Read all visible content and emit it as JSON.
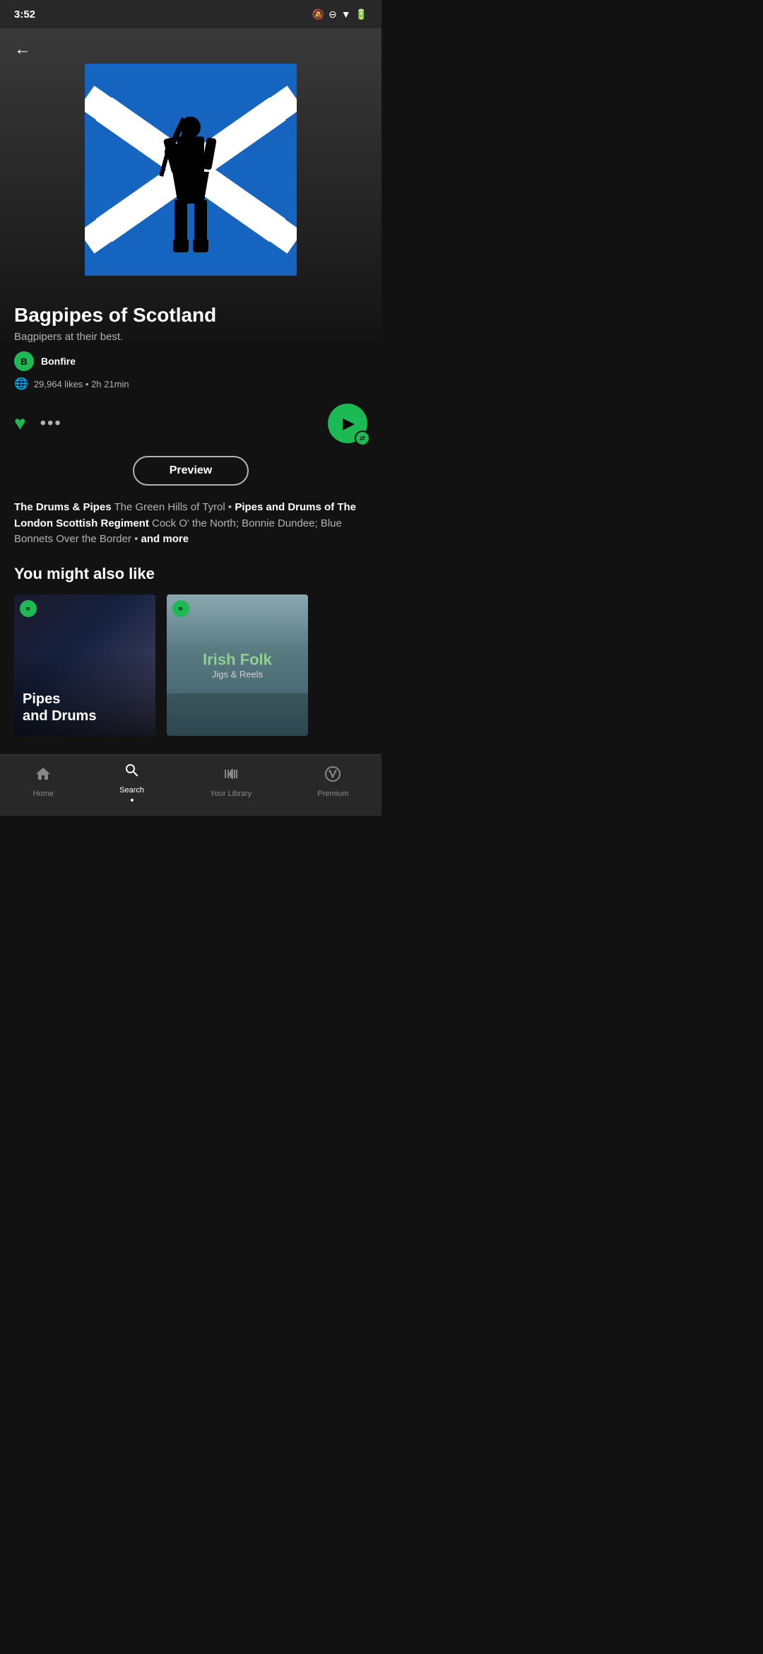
{
  "statusBar": {
    "time": "3:52",
    "icons": [
      "bell-off",
      "minus-circle",
      "wifi",
      "battery"
    ]
  },
  "header": {
    "backLabel": "←"
  },
  "playlist": {
    "title": "Bagpipes of Scotland",
    "subtitle": "Bagpipers at their best.",
    "creator": {
      "initial": "B",
      "name": "Bonfire"
    },
    "likes": "29,964 likes",
    "duration": "2h 21min",
    "metaText": "29,964 likes • 2h 21min"
  },
  "actions": {
    "heartLabel": "♥",
    "moreLabel": "•••",
    "playLabel": "▶",
    "shuffleLabel": "⇄"
  },
  "preview": {
    "label": "Preview"
  },
  "trackDescription": {
    "highlighted": "The Drums & Pipes",
    "text1": " The Green Hills of Tyrol • ",
    "highlighted2": "Pipes and Drums of The London Scottish Regiment",
    "text2": " Cock O' the North; Bonnie Dundee; Blue Bonnets Over the Border •",
    "moreLink": " and more"
  },
  "recommendations": {
    "sectionTitle": "You might also like",
    "cards": [
      {
        "id": "pipes-and-drums",
        "title": "Pipes\nand Drums",
        "style": "dark-pipes"
      },
      {
        "id": "irish-folk",
        "mainTitle": "Irish Folk",
        "subTitle": "Jigs & Reels",
        "style": "irish"
      }
    ]
  },
  "bottomNav": {
    "items": [
      {
        "id": "home",
        "label": "Home",
        "icon": "home",
        "active": false
      },
      {
        "id": "search",
        "label": "Search",
        "icon": "search",
        "active": true
      },
      {
        "id": "library",
        "label": "Your Library",
        "icon": "library",
        "active": false
      },
      {
        "id": "premium",
        "label": "Premium",
        "icon": "premium",
        "active": false
      }
    ]
  }
}
